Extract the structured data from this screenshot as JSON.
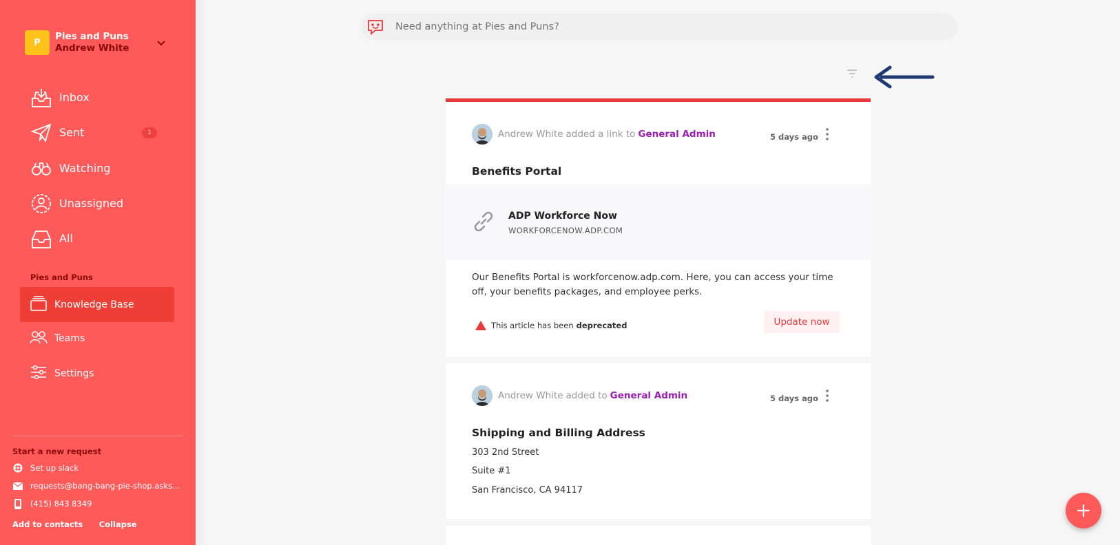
{
  "org": {
    "avatar_letter": "P",
    "name": "Pies and Puns",
    "user": "Andrew White"
  },
  "nav": {
    "inbox": "Inbox",
    "sent": "Sent",
    "sent_badge": "1",
    "watching": "Watching",
    "unassigned": "Unassigned",
    "all": "All"
  },
  "section": {
    "label": "Pies and Puns",
    "knowledge_base": "Knowledge Base",
    "teams": "Teams",
    "settings": "Settings"
  },
  "footer": {
    "title": "Start a new request",
    "slack": "Set up slack",
    "email": "requests@bang-bang-pie-shop.asks...",
    "phone": "(415) 843 8349",
    "add_contacts": "Add to contacts",
    "collapse": "Collapse"
  },
  "search": {
    "placeholder": "Need anything at Pies and Puns?"
  },
  "cards": [
    {
      "author": "Andrew White",
      "action": "added a link to",
      "target": "General Admin",
      "time": "5 days ago",
      "title": "Benefits Portal",
      "link_title": "ADP Workforce Now",
      "link_url": "WORKFORCENOW.ADP.COM",
      "description": "Our Benefits Portal is workforcenow.adp.com. Here, you can access your time off, your benefits packages, and employee perks.",
      "warning_prefix": "This article has been",
      "warning_strong": "deprecated",
      "update_label": "Update now"
    },
    {
      "author": "Andrew White",
      "action": "added to",
      "target": "General Admin",
      "time": "5 days ago",
      "title": "Shipping and Billing Address",
      "address_lines": [
        "303 2nd Street",
        "Suite #1",
        "San Francisco, CA 94117"
      ]
    }
  ],
  "colors": {
    "sidebar": "#ff5a5a",
    "sidebar_active": "#ef3e36",
    "accent_purple": "#9b1fb5",
    "alert_red": "#e83a3a",
    "arrow_navy": "#1f3a6e",
    "org_avatar": "#ffc21a"
  }
}
